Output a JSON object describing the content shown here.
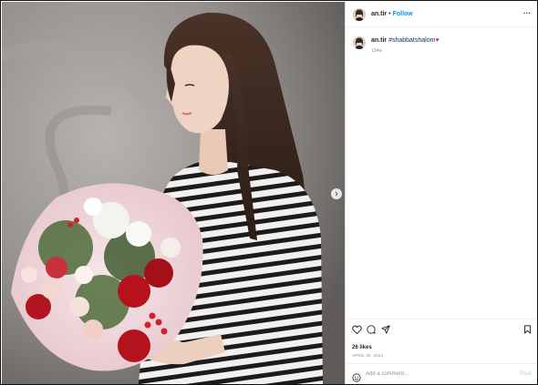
{
  "post": {
    "username": "an.tir",
    "follow_label": "Follow",
    "dot": "•",
    "more_label": "···",
    "caption_user": "an.tir",
    "caption_tag": "#shabbatshalom",
    "caption_emoji": "♥",
    "caption_time": "134w",
    "likes": "26 likes",
    "date": "APRIL 30, 2021"
  },
  "comment": {
    "placeholder": "Add a comment...",
    "post_label": "Post"
  },
  "colors": {
    "link_blue": "#0095f6",
    "text": "#262626",
    "muted": "#8e8e8e",
    "heart": "#e0245e"
  },
  "icons": [
    "heart-icon",
    "comment-icon",
    "share-icon",
    "bookmark-icon",
    "emoji-icon",
    "more-icon",
    "next-arrow-icon"
  ]
}
